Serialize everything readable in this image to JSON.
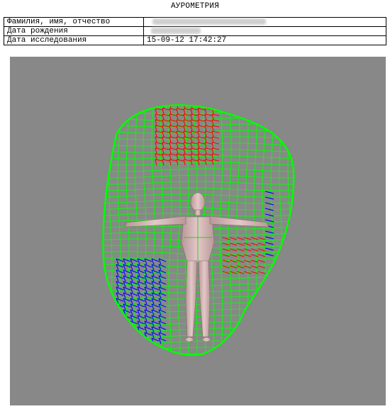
{
  "document": {
    "title": "АУРОМЕТРИЯ"
  },
  "info_table": {
    "rows": [
      {
        "label": "Фамилия, имя, отчество",
        "value": "",
        "value_obscured": true
      },
      {
        "label": "Дата рождения",
        "value": "",
        "value_obscured": true
      },
      {
        "label": "Дата исследования",
        "value": "15-09-12 17:42:27",
        "value_obscured": false
      }
    ]
  },
  "visualization": {
    "background_color": "#888888",
    "aura_mesh_colors": {
      "main": "#00ff00",
      "upper_zone": "#ff0000",
      "lower_zone": "#0000ff"
    },
    "figure_color": "#dcbcbc"
  }
}
